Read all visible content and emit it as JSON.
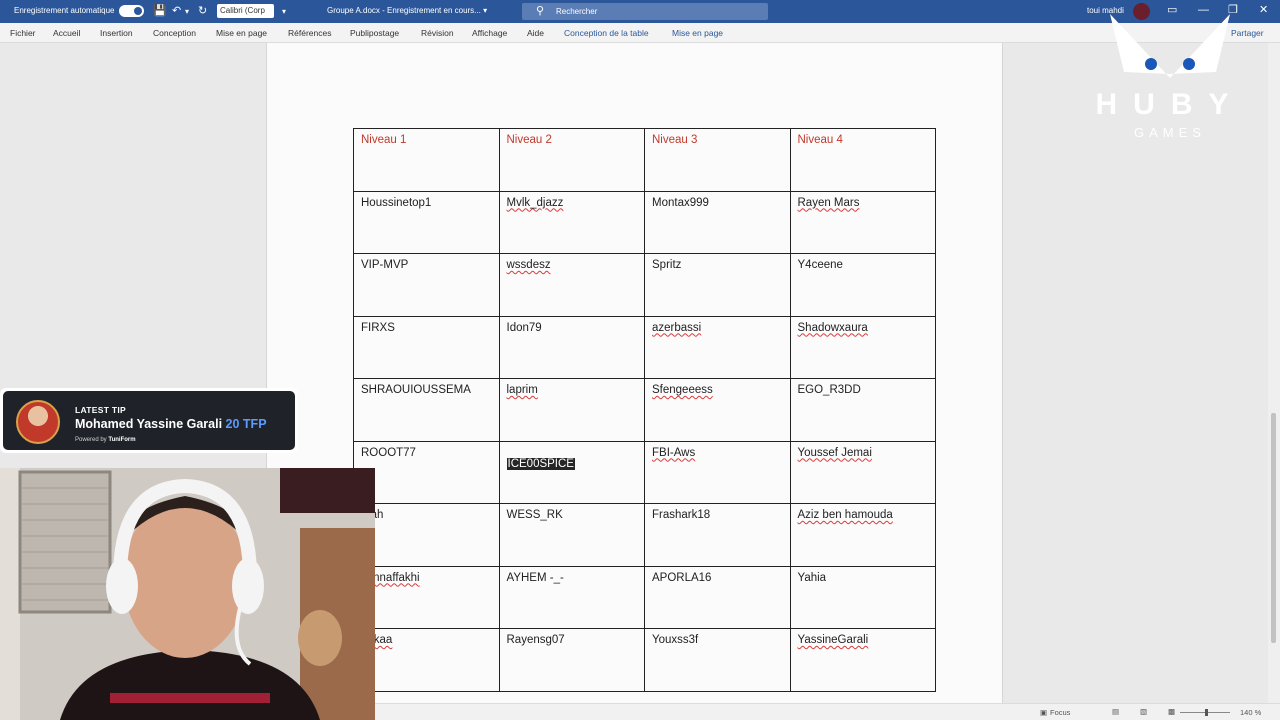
{
  "titlebar": {
    "autosave_label": "Enregistrement automatique",
    "font_name": "Calibri (Corp",
    "doc_title": "Groupe A.docx  -  Enregistrement en cours...  ▾",
    "search_placeholder": "Rechercher",
    "user_name": "toui mahdi"
  },
  "ribbon": {
    "tabs": [
      "Fichier",
      "Accueil",
      "Insertion",
      "Conception",
      "Mise en page",
      "Références",
      "Publipostage",
      "Révision",
      "Affichage",
      "Aide"
    ],
    "context_tabs": [
      "Conception de la table",
      "Mise en page"
    ],
    "share_label": "Partager"
  },
  "table": {
    "headers": [
      "Niveau 1",
      "Niveau 2",
      "Niveau 3",
      "Niveau 4"
    ],
    "rows": [
      [
        "Houssinetop1",
        "Mvlk_djazz",
        "Montax999",
        "Rayen Mars"
      ],
      [
        "VIP-MVP",
        "wssdesz",
        "Spritz",
        "Y4ceene"
      ],
      [
        "FIRXS",
        "Idon79",
        "azerbassi",
        "Shadowxaura"
      ],
      [
        "SHRAOUIOUSSEMA",
        "laprim",
        "Sfengeeess",
        "EGO_R3DD"
      ],
      [
        "ROOOT77",
        "ICE00SPICE",
        "FBI-Aws",
        "Youssef Jemai"
      ],
      [
        "htah",
        "WESS_RK",
        "Frashark18",
        "Aziz ben hamouda"
      ],
      [
        "yennaffakhi",
        "AYHEM -_-",
        "APORLA16",
        "Yahia"
      ],
      [
        "oukaa",
        "Rayensg07",
        "Youxss3f",
        "YassineGarali"
      ]
    ]
  },
  "overlay": {
    "logo_text": "HUBY",
    "logo_sub": "GAMES",
    "tip_label": "LATEST TIP",
    "tip_name": "Mohamed Yassine Garali",
    "tip_amount": "20 TFP",
    "tip_powered": "Powered by",
    "tip_brand": "TuniForm"
  },
  "statusbar": {
    "focus_label": "Focus",
    "zoom": "140 %"
  }
}
